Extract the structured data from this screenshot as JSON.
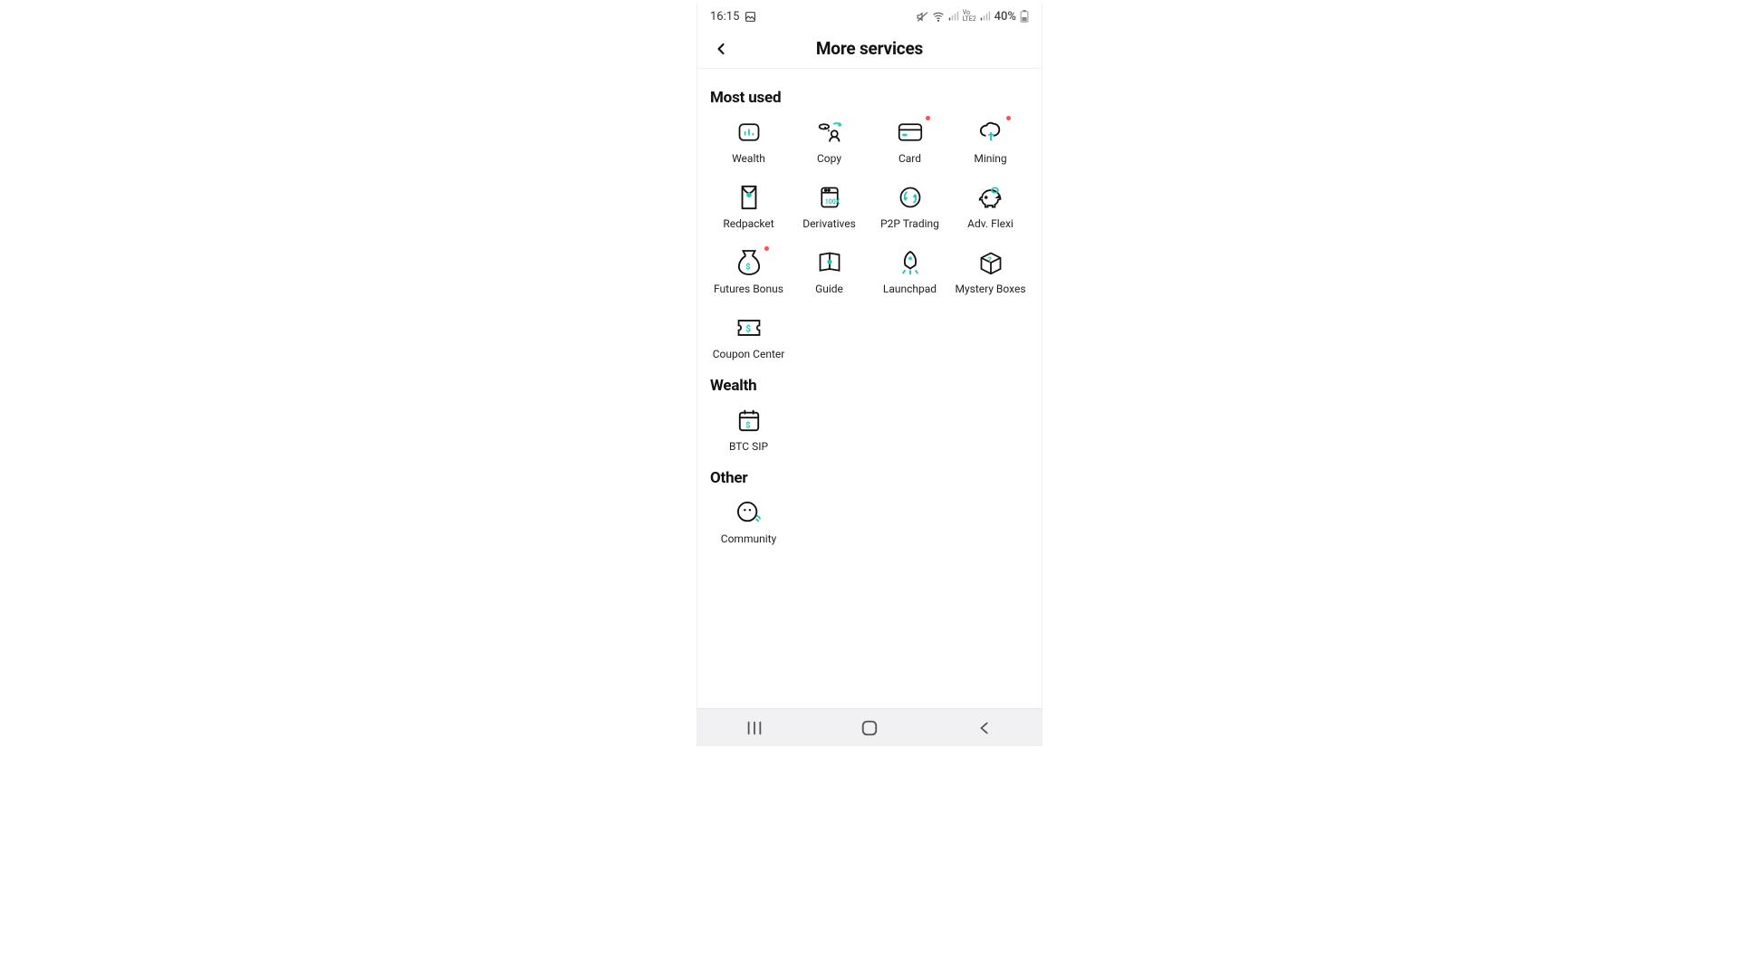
{
  "status": {
    "time": "16:15",
    "battery": "40%"
  },
  "title": "More services",
  "sections": [
    {
      "title": "Most used",
      "items": [
        {
          "label": "Wealth",
          "icon": "wealth",
          "badge": false
        },
        {
          "label": "Copy",
          "icon": "copy",
          "badge": false
        },
        {
          "label": "Card",
          "icon": "card",
          "badge": true
        },
        {
          "label": "Mining",
          "icon": "mining",
          "badge": true
        },
        {
          "label": "Redpacket",
          "icon": "redpacket",
          "badge": false
        },
        {
          "label": "Derivatives",
          "icon": "derivatives",
          "badge": false
        },
        {
          "label": "P2P Trading",
          "icon": "p2p",
          "badge": false
        },
        {
          "label": "Adv. Flexi",
          "icon": "flexi",
          "badge": false
        },
        {
          "label": "Futures Bonus",
          "icon": "futures",
          "badge": true
        },
        {
          "label": "Guide",
          "icon": "guide",
          "badge": false
        },
        {
          "label": "Launchpad",
          "icon": "launchpad",
          "badge": false
        },
        {
          "label": "Mystery Boxes",
          "icon": "mystery",
          "badge": false
        }
      ],
      "tail": [
        {
          "label": "Coupon Center",
          "icon": "coupon",
          "badge": false
        }
      ]
    },
    {
      "title": "Wealth",
      "items": [
        {
          "label": "BTC SIP",
          "icon": "btcsip",
          "badge": false
        }
      ]
    },
    {
      "title": "Other",
      "items": [
        {
          "label": "Community",
          "icon": "community",
          "badge": false
        }
      ]
    }
  ]
}
